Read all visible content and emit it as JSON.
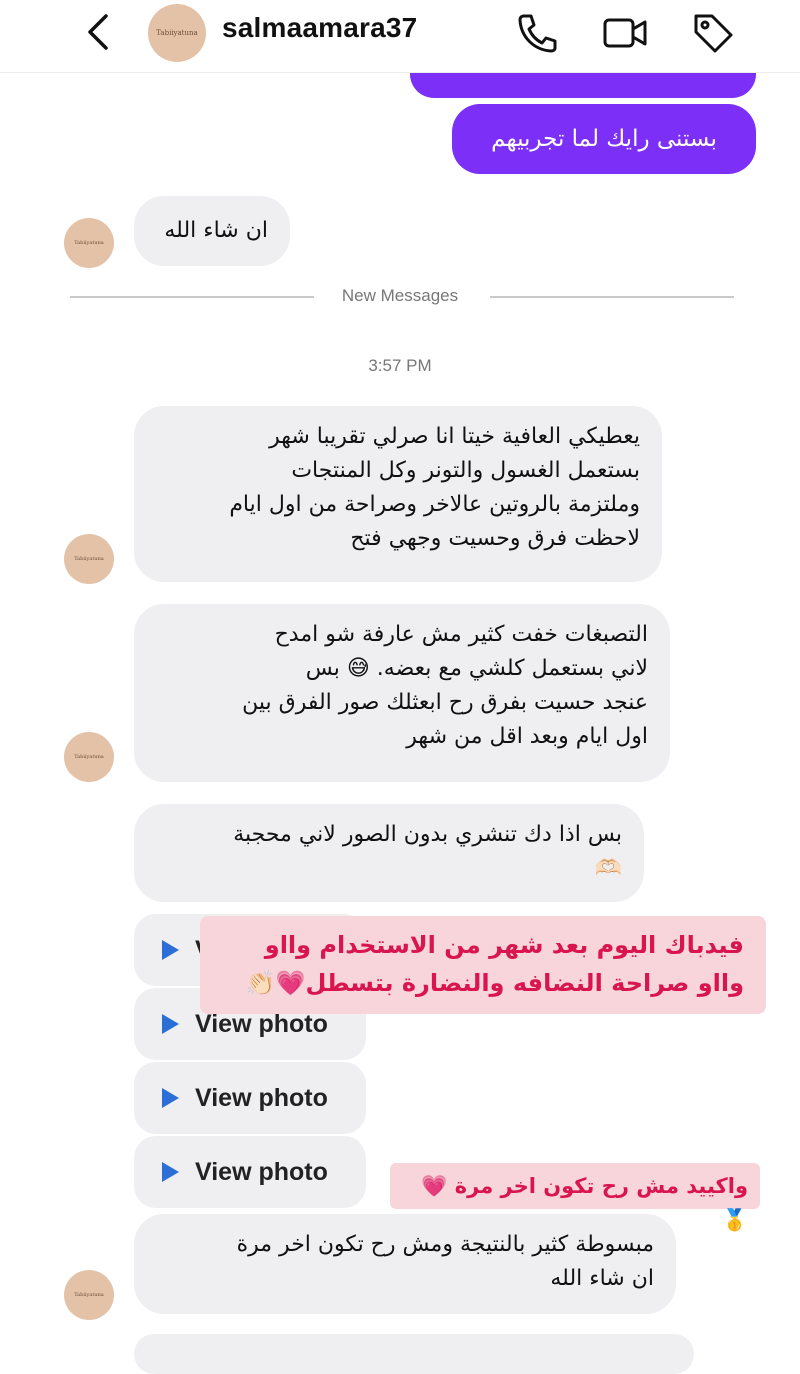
{
  "header": {
    "username": "salmaamara37",
    "avatar_text": "Tabiiyatuna"
  },
  "messages": {
    "partial_outgoing": "",
    "outgoing_1": "بستنى رايك لما تجربيهم",
    "incoming_1": "ان شاء الله",
    "new_messages_label": "New Messages",
    "timestamp": "3:57 PM",
    "incoming_2": "يعطيكي العافية خيتا انا صرلي تقريبا شهر\nبستعمل  الغسول والتونر وكل المنتجات\nوملتزمة بالروتين عالاخر وصراحة من اول ايام\nلاحظت فرق وحسيت وجهي فتح",
    "incoming_3": "التصبغات خفت كثير مش عارفة شو امدح\nلاني بستعمل كلشي  مع   بعضه. 😅 بس\nعنجد حسيت بفرق رح ابعثلك صور الفرق بين\nاول ايام وبعد اقل من شهر",
    "incoming_4": "بس اذا دك تنشري بدون الصور لاني محجبة\n🫶🏻",
    "view_photo_label": "View photo",
    "incoming_5": "مبسوطة كثير بالنتيجة ومش رح تكون اخر مرة\nان شاء الله"
  },
  "overlays": {
    "caption_1": "فيدباك اليوم بعد شهر من الاستخدام  وااو\nوااو صراحة النضافه والنضارة بتسطل💗👏🏻",
    "caption_2": "واكييد مش رح تكون اخر مرة 💗🥇"
  },
  "icons": [
    "back-chevron-icon",
    "phone-icon",
    "video-camera-icon",
    "tag-icon",
    "play-icon"
  ],
  "colors": {
    "outgoing_bubble": "#7b2ff7",
    "incoming_bubble": "#efeff2",
    "overlay_background": "#f8d5da",
    "overlay_text": "#d9154f",
    "play_icon": "#2b6fd6"
  }
}
